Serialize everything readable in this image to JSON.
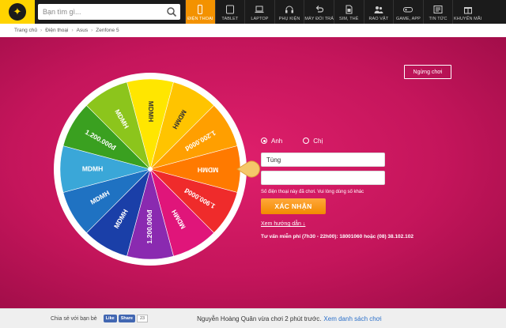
{
  "header": {
    "search_placeholder": "Bạn tìm gì...",
    "nav": [
      {
        "label": "ĐIỆN THOẠI",
        "icon": "phone-icon",
        "active": true
      },
      {
        "label": "TABLET",
        "icon": "tablet-icon",
        "active": false
      },
      {
        "label": "LAPTOP",
        "icon": "laptop-icon",
        "active": false
      },
      {
        "label": "PHỤ KIỆN",
        "icon": "headphone-icon",
        "active": false
      },
      {
        "label": "MÁY ĐỔI TRẢ",
        "icon": "return-icon",
        "active": false
      },
      {
        "label": "SIM, THẺ",
        "icon": "sim-card-icon",
        "active": false
      },
      {
        "label": "RAO VẶT",
        "icon": "people-icon",
        "active": false
      },
      {
        "label": "GAME, APP",
        "icon": "gamepad-icon",
        "active": false
      },
      {
        "label": "TIN TỨC",
        "icon": "news-icon",
        "active": false
      },
      {
        "label": "KHUYẾN MÃI",
        "icon": "gift-icon",
        "active": false
      }
    ]
  },
  "breadcrumb": [
    "Trang chủ",
    "Điện thoại",
    "Asus",
    "Zenfone 5"
  ],
  "game": {
    "stop_label": "Ngừng chơi",
    "wheel_segments": [
      {
        "label": "MDMH",
        "color": "#ffe600"
      },
      {
        "label": "MDMH",
        "color": "#ffc400"
      },
      {
        "label": "1.200.000đ",
        "color": "#ff9f00"
      },
      {
        "label": "MDMH",
        "color": "#ff7a00"
      },
      {
        "label": "1.900.000đ",
        "color": "#ef2b2b"
      },
      {
        "label": "MDMH",
        "color": "#e0157a"
      },
      {
        "label": "1.200.000đ",
        "color": "#8a2ab0"
      },
      {
        "label": "MDMH",
        "color": "#1a3fa8"
      },
      {
        "label": "MDMH",
        "color": "#1f72c2"
      },
      {
        "label": "MDMH",
        "color": "#3aa7d8"
      },
      {
        "label": "1.200.000đ",
        "color": "#3aa020"
      },
      {
        "label": "MDMH",
        "color": "#8cc51c"
      }
    ]
  },
  "form": {
    "gender_male": "Anh",
    "gender_female": "Chị",
    "name_value": "Tùng",
    "phone_value": "",
    "error_text": "Số điện thoại này đã chơi. Vui lòng dùng số khác",
    "confirm_label": "XÁC NHẬN",
    "guide_link": "Xem hướng dẫn ↓",
    "hotline": "Tư vấn miễn phí (7h30 - 22h00): 18001060 hoặc (08) 38.102.102"
  },
  "footer": {
    "share_label": "Chia sẻ với bạn bè",
    "like_label": "Like",
    "share_button": "Share",
    "share_count": "23",
    "recent_text": "Nguyễn Hoàng Quân vừa chơi 2 phút trước.",
    "recent_link": "Xem danh sách chơi"
  }
}
